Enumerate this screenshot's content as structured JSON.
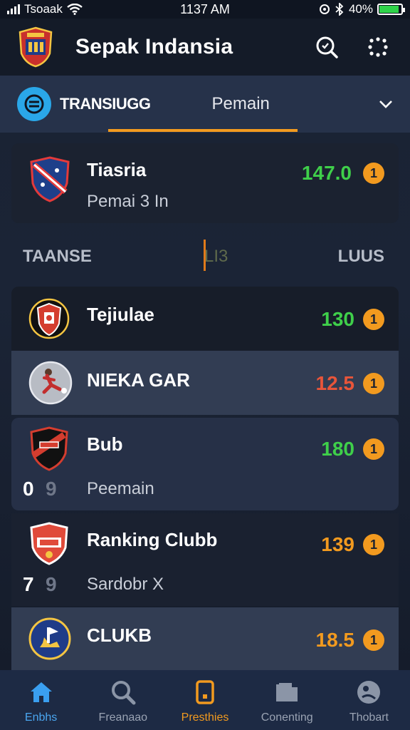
{
  "status": {
    "carrier": "Tsoaak",
    "time": "1137 AM",
    "battery": "40%",
    "battery_level": 0.9
  },
  "header": {
    "title": "Sepak Indansia",
    "icons": [
      "search-icon",
      "grid-menu-icon"
    ]
  },
  "tabs": {
    "first_label": "TRANSIUGG",
    "second_label": "Pemain",
    "dropdown_icon": "chevron-down-icon"
  },
  "featured": {
    "name": "Tiasria",
    "sub": "Pemai 3 In",
    "score": "147.0",
    "badge": "1",
    "score_color": "#3fcf4a"
  },
  "columns": {
    "left": "TAANSE",
    "mid": "LI3",
    "right": "LUUS"
  },
  "rows": [
    {
      "name": "Tejiulae",
      "score": "130",
      "badge": "1",
      "score_color": "#3fcf4a",
      "sub": "",
      "rank": "",
      "rank2": ""
    },
    {
      "name": "NIEKA GAR",
      "score": "12.5",
      "badge": "1",
      "score_color": "#e8553a",
      "sub": "",
      "rank": "",
      "rank2": ""
    },
    {
      "name": "Bub",
      "score": "180",
      "badge": "1",
      "score_color": "#3fcf4a",
      "sub": "Peemain",
      "rank": "0",
      "rank2": "9"
    },
    {
      "name": "Ranking Clubb",
      "score": "139",
      "badge": "1",
      "score_color": "#f29a1f",
      "sub": "Sardobr X",
      "rank": "7",
      "rank2": "9"
    },
    {
      "name": "CLUKB",
      "score": "18.5",
      "badge": "1",
      "score_color": "#f29a1f",
      "sub": "",
      "rank": "",
      "rank2": ""
    }
  ],
  "nav": [
    {
      "label": "Enbhs",
      "icon": "home-icon"
    },
    {
      "label": "Freanaao",
      "icon": "search-icon"
    },
    {
      "label": "Presthies",
      "icon": "phone-icon"
    },
    {
      "label": "Conenting",
      "icon": "folder-icon"
    },
    {
      "label": "Thobart",
      "icon": "profile-icon"
    }
  ],
  "colors": {
    "accent": "#f29a1f",
    "blue": "#2aa7e8",
    "green": "#3fcf4a",
    "red": "#e8553a"
  }
}
